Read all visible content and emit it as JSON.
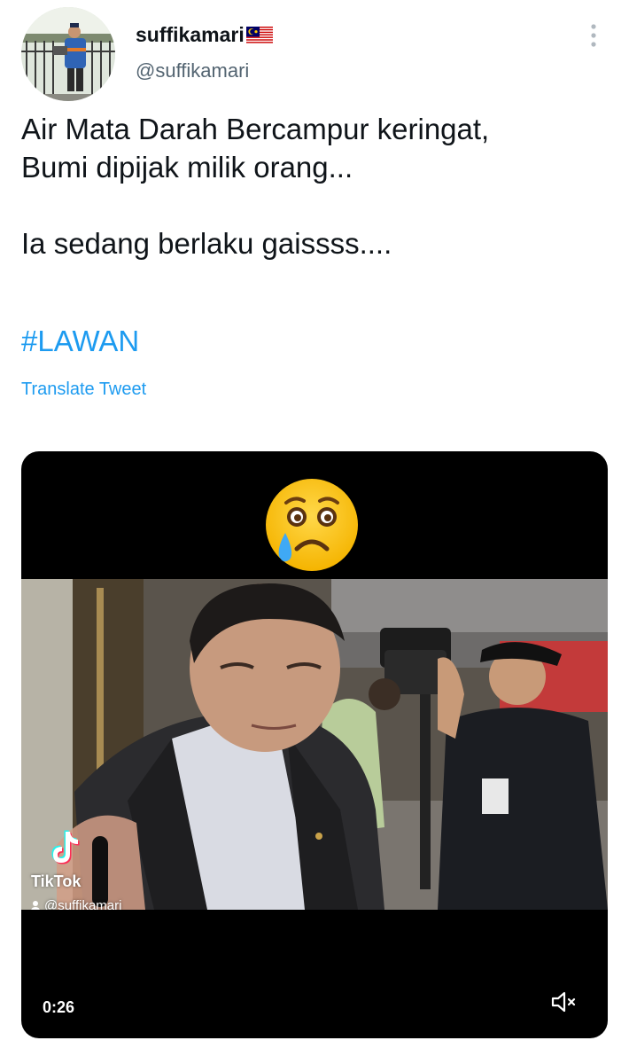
{
  "tweet": {
    "author": {
      "display_name": "suffikamari",
      "handle": "@suffikamari",
      "flag_icon": "malaysia-flag-icon",
      "avatar_icon": "avatar-photo"
    },
    "more_icon": "more-vertical-icon",
    "text_lines": [
      "Air Mata Darah Bercampur keringat,",
      "Bumi dipijak milik orang...",
      "",
      "Ia sedang berlaku gaissss...."
    ],
    "hashtag": "#LAWAN",
    "translate_label": "Translate Tweet",
    "colors": {
      "link": "#1d9bf0",
      "text": "#0f1419",
      "secondary": "#536471",
      "media_bg": "#000000"
    }
  },
  "media": {
    "emoji_icon": "crying-face-emoji",
    "watermark_brand": "TikTok",
    "watermark_handle": "@suffikamari",
    "duration": "0:26",
    "mute_icon": "volume-muted-icon"
  }
}
